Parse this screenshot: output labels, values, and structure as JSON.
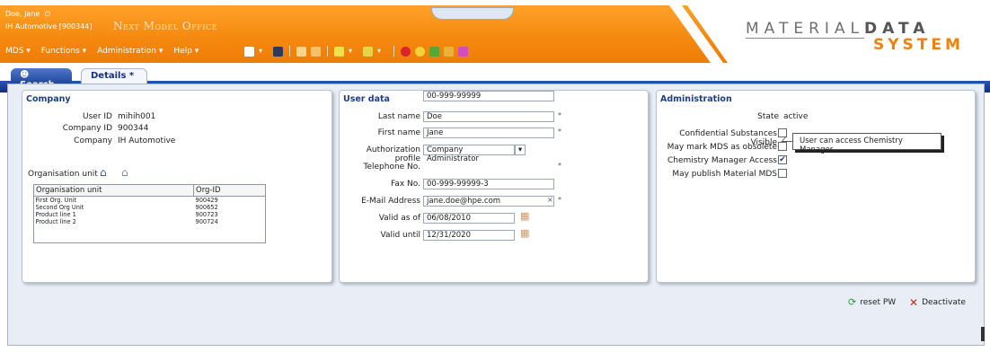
{
  "header": {
    "user_name": "Doe, Jane",
    "company": "IH Automotive [900344]",
    "app_title": "Next Model Office",
    "logo_top": "MATERIAL",
    "logo_top_bold": "DATA",
    "logo_bottom": "SYSTEM"
  },
  "menu": [
    "MDS ▾",
    "Functions ▾",
    "Administration ▾",
    "Help ▾"
  ],
  "tabs": {
    "search": "Search",
    "details": "Details *"
  },
  "company": {
    "title": "Company",
    "user_id_label": "User ID",
    "user_id": "mihih001",
    "company_id_label": "Company ID",
    "company_id": "900344",
    "company_label": "Company",
    "company_value": "IH Automotive",
    "org_unit_label": "Organisation unit",
    "table_headers": [
      "Organisation unit",
      "Org-ID"
    ],
    "rows": [
      [
        "First Org. Unit",
        "900429"
      ],
      [
        "Second Org Unit",
        "900652"
      ],
      [
        "Product line 1",
        "900723"
      ],
      [
        "Product line 2",
        "900724"
      ]
    ]
  },
  "user_data": {
    "title": "User data",
    "last_name_label": "Last name",
    "last_name": "Doe",
    "first_name_label": "First name",
    "first_name": "Jane",
    "auth_label": "Authorization profile",
    "auth": "Company Administrator",
    "phone_label": "Telephone No.",
    "phone": "00-999-99999",
    "fax_label": "Fax No.",
    "fax": "00-999-99999-3",
    "email_label": "E-Mail Address",
    "email": "jane.doe@hpe.com",
    "valid_from_label": "Valid as of",
    "valid_from": "06/08/2010",
    "valid_until_label": "Valid until",
    "valid_until": "12/31/2020",
    "required_mark": "*",
    "clear_mark": "×"
  },
  "administration": {
    "title": "Administration",
    "state_label": "State",
    "state": "active",
    "confidential_label": "Confidential Substances Visible",
    "obsolete_label": "May mark MDS as obsolete",
    "chemistry_label": "Chemistry Manager Access",
    "publish_label": "May publish Material MDS",
    "check_mark": "✔",
    "tooltip": "User can access Chemistry Manager"
  },
  "actions": {
    "reset": "reset PW",
    "deactivate": "Deactivate"
  },
  "colors": {
    "orange": "#f58a10",
    "navy": "#1a3a8c",
    "title_blue": "#1c3f86"
  }
}
